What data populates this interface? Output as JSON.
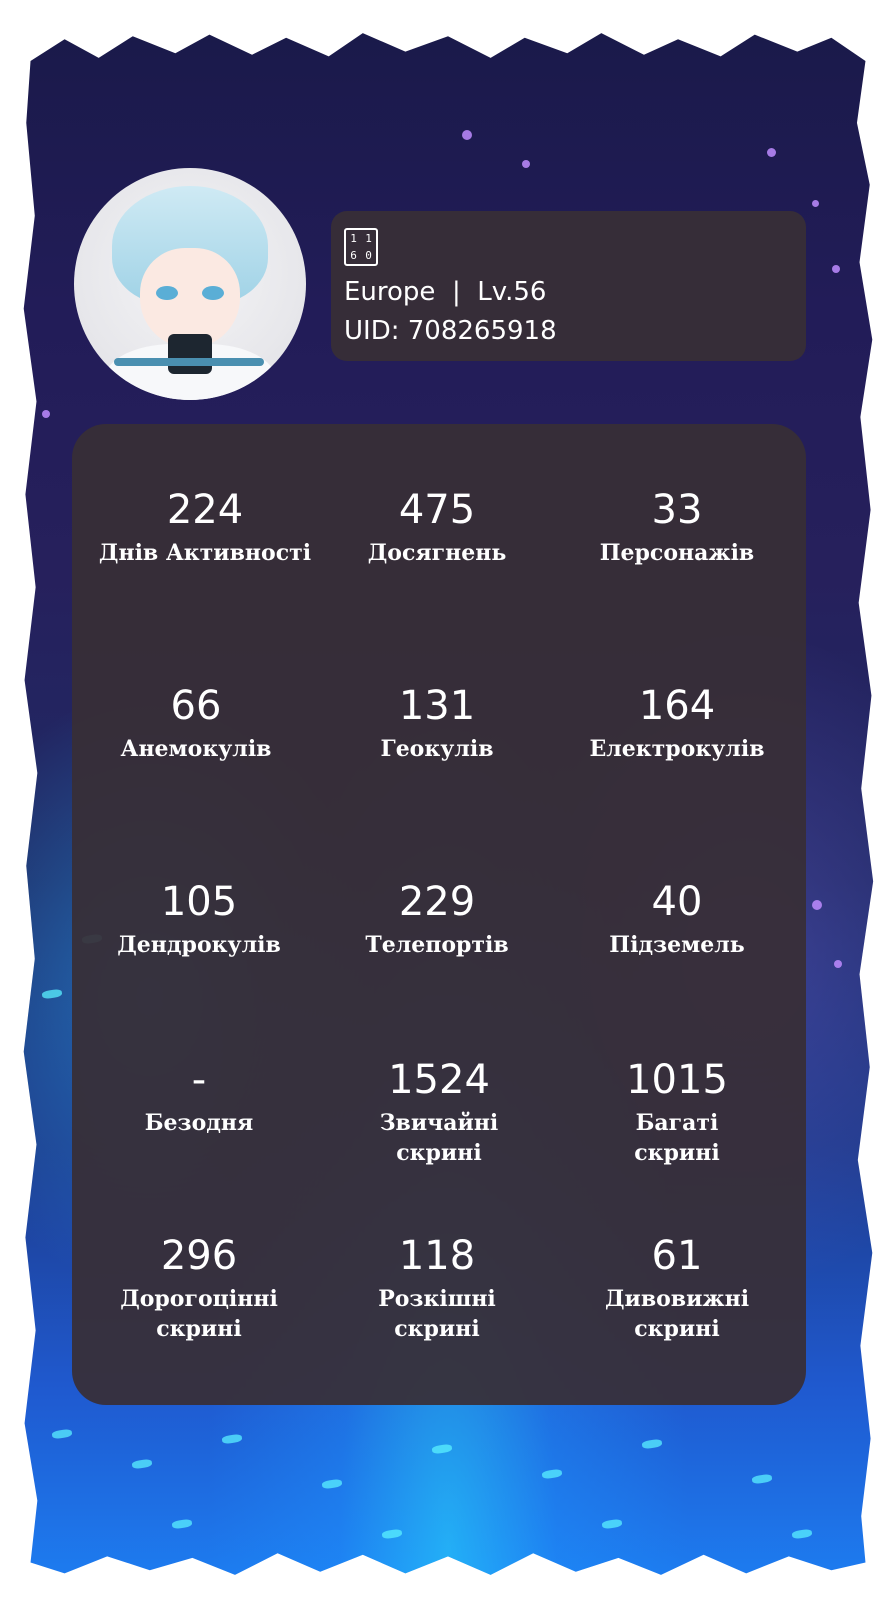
{
  "profile": {
    "name_glyph": [
      "1",
      "1",
      "6",
      "0"
    ],
    "server": "Europe",
    "separator": "|",
    "level": "Lv.56",
    "uid": "UID: 708265918"
  },
  "stats": [
    {
      "value": "224",
      "label": "Днів Активності"
    },
    {
      "value": "475",
      "label": "Досягнень"
    },
    {
      "value": "33",
      "label": "Персонажів"
    },
    {
      "value": "66",
      "label": "Анемокулів"
    },
    {
      "value": "131",
      "label": "Геокулів"
    },
    {
      "value": "164",
      "label": "Електрокулів"
    },
    {
      "value": "105",
      "label": "Дендрокулів"
    },
    {
      "value": "229",
      "label": "Телепортів"
    },
    {
      "value": "40",
      "label": "Підземель"
    },
    {
      "value": "-",
      "label": "Безодня"
    },
    {
      "value": "1524",
      "label": "Звичайні скрині"
    },
    {
      "value": "1015",
      "label": "Багаті скрині"
    },
    {
      "value": "296",
      "label": "Дорогоцінні скрині"
    },
    {
      "value": "118",
      "label": "Розкішні скрині"
    },
    {
      "value": "61",
      "label": "Дивовижні скрині"
    }
  ]
}
